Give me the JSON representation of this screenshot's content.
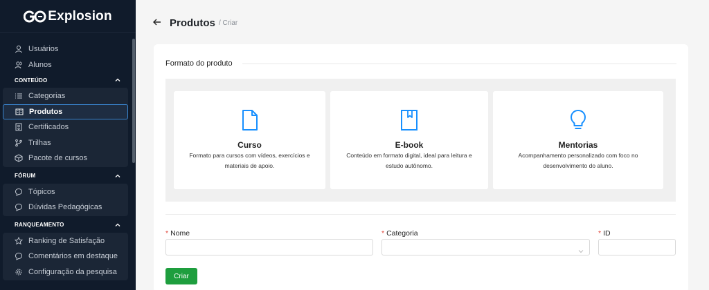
{
  "brand": {
    "logo_text": "Explosion",
    "logo_mark": "GO"
  },
  "sidebar": {
    "top_items": [
      {
        "label": "Usuários",
        "icon": "user-icon"
      },
      {
        "label": "Alunos",
        "icon": "users-icon"
      }
    ],
    "sections": [
      {
        "title": "CONTEÚDO",
        "items": [
          {
            "label": "Categorias",
            "icon": "list-icon"
          },
          {
            "label": "Produtos",
            "icon": "book-icon",
            "active": true
          },
          {
            "label": "Certificados",
            "icon": "certificate-icon"
          },
          {
            "label": "Trilhas",
            "icon": "branch-icon"
          },
          {
            "label": "Pacote de cursos",
            "icon": "package-icon"
          }
        ]
      },
      {
        "title": "FÓRUM",
        "items": [
          {
            "label": "Tópicos",
            "icon": "chat-icon"
          },
          {
            "label": "Dúvidas Pedagógicas",
            "icon": "chat-icon"
          }
        ]
      },
      {
        "title": "RANQUEAMENTO",
        "items": [
          {
            "label": "Ranking de Satisfação",
            "icon": "star-icon"
          },
          {
            "label": "Comentários em destaque",
            "icon": "chat-icon"
          },
          {
            "label": "Configuração da pesquisa",
            "icon": "gear-icon"
          }
        ]
      }
    ]
  },
  "header": {
    "title": "Produtos",
    "breadcrumb": "/ Criar"
  },
  "form": {
    "section_title": "Formato do produto",
    "product_types": [
      {
        "name": "Curso",
        "description": "Formato para cursos com vídeos, exercícios e materiais de apoio.",
        "icon": "file-icon"
      },
      {
        "name": "E-book",
        "description": "Conteúdo em formato digital, ideal para leitura e estudo autônomo.",
        "icon": "ebook-icon"
      },
      {
        "name": "Mentorias",
        "description": "Acompanhamento personalizado com foco no desenvolvimento do aluno.",
        "icon": "lightbulb-icon"
      }
    ],
    "fields": {
      "name": {
        "label": "Nome",
        "value": "",
        "placeholder": ""
      },
      "category": {
        "label": "Categoria",
        "value": ""
      },
      "id": {
        "label": "ID",
        "value": ""
      }
    },
    "submit_label": "Criar"
  },
  "colors": {
    "sidebar_bg": "#101b2b",
    "accent": "#1890ff",
    "success": "#1e9e3e",
    "required": "#e0453a"
  }
}
